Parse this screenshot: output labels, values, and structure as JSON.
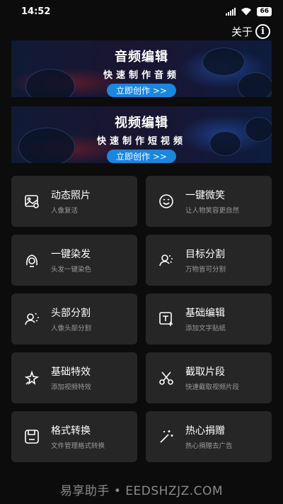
{
  "status": {
    "time": "14:52",
    "battery": "66"
  },
  "header": {
    "about_label": "关于",
    "info_glyph": "i"
  },
  "banners": [
    {
      "title": "音频编辑",
      "subtitle": "快速制作音频",
      "button": "立即创作 >>"
    },
    {
      "title": "视频编辑",
      "subtitle": "快速制作短视频",
      "button": "立即创作 >>"
    }
  ],
  "features": [
    {
      "title": "动态照片",
      "desc": "人像复活",
      "icon": "photo-icon"
    },
    {
      "title": "一键微笑",
      "desc": "让人物笑容更自然",
      "icon": "smile-icon"
    },
    {
      "title": "一键染发",
      "desc": "头发一键染色",
      "icon": "hair-icon"
    },
    {
      "title": "目标分割",
      "desc": "万物皆可分割",
      "icon": "segment-icon"
    },
    {
      "title": "头部分割",
      "desc": "人像头部分割",
      "icon": "head-segment-icon"
    },
    {
      "title": "基础编辑",
      "desc": "添加文字贴纸",
      "icon": "text-add-icon"
    },
    {
      "title": "基础特效",
      "desc": "添加视频特效",
      "icon": "sparkle-icon"
    },
    {
      "title": "截取片段",
      "desc": "快速截取视频片段",
      "icon": "scissors-icon"
    },
    {
      "title": "格式转换",
      "desc": "文件管理格式转换",
      "icon": "save-icon"
    },
    {
      "title": "热心捐赠",
      "desc": "热心捐赠去广告",
      "icon": "magic-wand-icon"
    }
  ],
  "watermark": "易享助手 • EEDSHZJZ.COM"
}
